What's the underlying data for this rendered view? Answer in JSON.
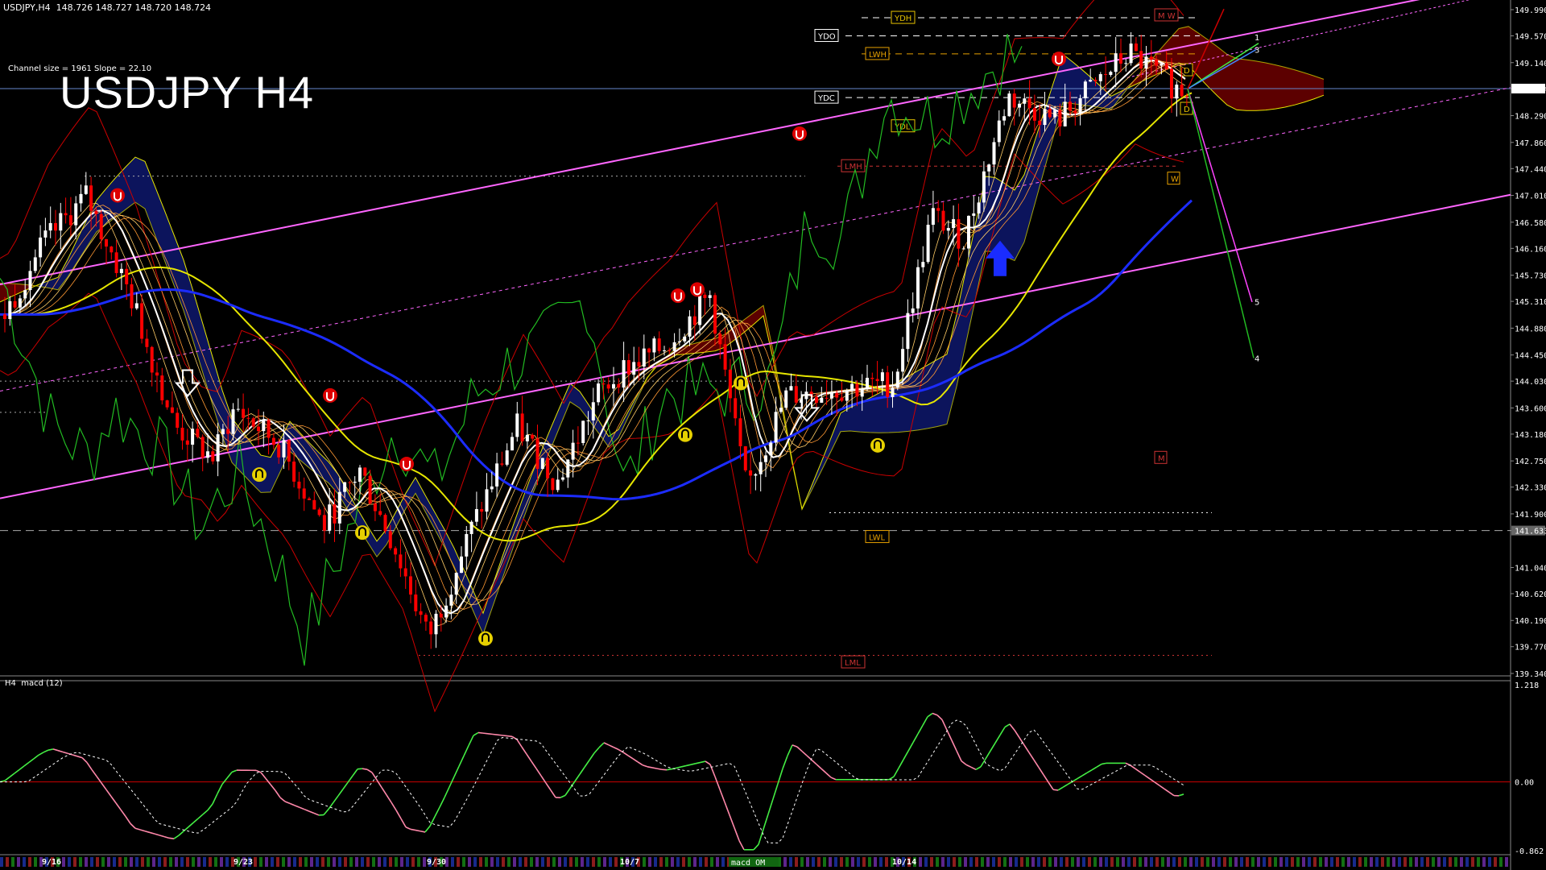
{
  "header": {
    "symbol_line": "USDJPY,H4  148.726 148.727 148.720 148.724",
    "channel_info": "Channel size = 1961 Slope = 22.10",
    "big_title": "USDJPY H4",
    "macd_title": "H4  macd (12)",
    "macd_tab_label": "macd OM"
  },
  "levels": {
    "YDH": "YDH",
    "YDO": "YDO",
    "YDC": "YDC",
    "YDL": "YDL",
    "LWH": "LWH",
    "LWL": "LWL",
    "LMH": "LMH",
    "LML": "LML",
    "M": "M",
    "W": "W",
    "D": "D",
    "MW": "M W"
  },
  "fib_labels": [
    "1",
    "3",
    "5",
    "4"
  ],
  "colors": {
    "background": "#000000",
    "channel": "#ff66ff",
    "ma_white": "#ffffff",
    "ma_yellow": "#e6e600",
    "ma_blue": "#1c2cff",
    "bollinger": "#cc0000",
    "chikou": "#22bb22",
    "kumo_bear": "#cc0000",
    "kumo_bull": "#1a2ccc",
    "macd_up": "#44ee44",
    "macd_down": "#ff88aa",
    "up_candle": "#ffffff",
    "down_candle": "#ff0000"
  },
  "chart_data": {
    "type": "candlestick",
    "symbol": "USDJPY",
    "timeframe": "H4",
    "current_price": 148.724,
    "marked_price": 141.633,
    "y_ticks": [
      "149.990",
      "149.570",
      "149.140",
      "148.724",
      "148.290",
      "147.860",
      "147.440",
      "147.010",
      "146.580",
      "146.160",
      "145.730",
      "145.310",
      "144.880",
      "144.450",
      "144.030",
      "143.600",
      "143.180",
      "142.750",
      "142.330",
      "141.900",
      "141.633",
      "141.040",
      "140.620",
      "140.190",
      "139.770",
      "139.340"
    ],
    "x_labels": [
      "9/16",
      "9/23",
      "9/30",
      "10/7",
      "10/14"
    ],
    "ylim": [
      139.34,
      149.99
    ],
    "price_path": [
      {
        "x": "9/13",
        "y": 145.1
      },
      {
        "x": "9/16",
        "y": 146.2
      },
      {
        "x": "9/17",
        "y": 147.0
      },
      {
        "x": "9/18",
        "y": 145.4
      },
      {
        "x": "9/19",
        "y": 143.3
      },
      {
        "x": "9/20",
        "y": 142.8
      },
      {
        "x": "9/23",
        "y": 143.6
      },
      {
        "x": "9/24",
        "y": 143.0
      },
      {
        "x": "9/25",
        "y": 141.7
      },
      {
        "x": "9/26",
        "y": 142.6
      },
      {
        "x": "9/27",
        "y": 141.3
      },
      {
        "x": "9/30",
        "y": 139.9
      },
      {
        "x": "10/1",
        "y": 141.7
      },
      {
        "x": "10/2",
        "y": 143.3
      },
      {
        "x": "10/3",
        "y": 142.4
      },
      {
        "x": "10/4",
        "y": 143.8
      },
      {
        "x": "10/7",
        "y": 144.2
      },
      {
        "x": "10/8",
        "y": 144.6
      },
      {
        "x": "10/9",
        "y": 145.4
      },
      {
        "x": "10/10",
        "y": 142.3
      },
      {
        "x": "10/11",
        "y": 143.8
      },
      {
        "x": "10/14",
        "y": 144.0
      },
      {
        "x": "10/15",
        "y": 146.7
      },
      {
        "x": "10/16",
        "y": 146.3
      },
      {
        "x": "10/17",
        "y": 148.6
      },
      {
        "x": "10/18",
        "y": 148.2
      },
      {
        "x": "10/21",
        "y": 149.3
      },
      {
        "x": "10/22",
        "y": 148.72
      }
    ],
    "macd": {
      "title": "H4  macd (12)",
      "y_ticks": [
        "1.218",
        "0.00",
        "-0.862"
      ],
      "ylim": [
        -0.862,
        1.218
      ]
    }
  }
}
